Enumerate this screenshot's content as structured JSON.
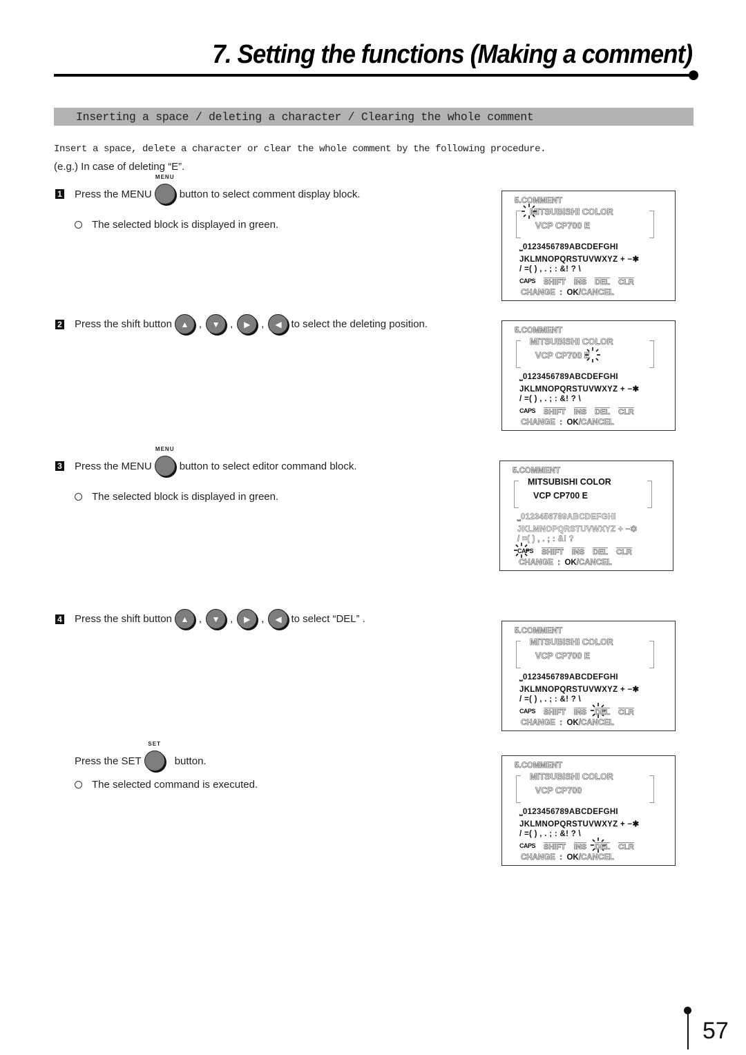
{
  "header": {
    "title": "7. Setting the functions (Making a comment)"
  },
  "section": {
    "heading": "Inserting a space / deleting a character / Clearing the whole comment",
    "intro": "Insert a space, delete a character or clear the whole comment by the following procedure.",
    "example": "(e.g.) In case of deleting “E”."
  },
  "buttons": {
    "menu_caption": "MENU",
    "set_caption": "SET",
    "up_icon": "▲",
    "down_icon": "▼",
    "right_icon": "▶",
    "left_icon": "◀"
  },
  "steps": [
    {
      "number": "1",
      "before": "Press the MENU",
      "after": "button to select comment display block.",
      "note": "The selected block is displayed in green."
    },
    {
      "number": "2",
      "before": "Press the shift button",
      "after": "to select the deleting position."
    },
    {
      "number": "3",
      "before": "Press the MENU",
      "after": "button to select editor command block.",
      "note": "The selected block is displayed in green."
    },
    {
      "number": "4",
      "before": "Press the shift button",
      "after": "to select  “DEL” ."
    },
    {
      "number": "",
      "before": "Press the SET",
      "after": "button.",
      "note": "The selected command is executed."
    }
  ],
  "screens": [
    {
      "title": "5.COMMENT",
      "line1": "MITSUBISHI  COLOR",
      "line2": "VCP CP700 E",
      "chars1": "⎵0123456789ABCDEFGHI",
      "chars2": "JKLMNOPQRSTUVWXYZ + −✱",
      "chars3": "/ =( ) , . ; : &! ? \\",
      "commands": [
        "CAPS",
        "SHIFT",
        "INS",
        "DEL",
        "CLR"
      ],
      "change": "CHANGE",
      "colon": ":",
      "ok": "OK",
      "cancel": "/CANCEL",
      "cursor": "M"
    },
    {
      "title": "5.COMMENT",
      "line1": "MITSUBISHI  COLOR",
      "line2": "VCP CP700 E",
      "chars1": "⎵0123456789ABCDEFGHI",
      "chars2": "JKLMNOPQRSTUVWXYZ + −✱",
      "chars3": "/ =( ) , . ; : &! ? \\",
      "commands": [
        "CAPS",
        "SHIFT",
        "INS",
        "DEL",
        "CLR"
      ],
      "change": "CHANGE",
      "colon": ":",
      "ok": "OK",
      "cancel": "/CANCEL",
      "cursor": "E"
    },
    {
      "title": "5.COMMENT",
      "line1": "MITSUBISHI  COLOR",
      "line2": "VCP CP700 E",
      "chars1": "⎵0123456789ABCDEFGHI",
      "chars2": "JKLMNOPQRSTUVWXYZ + −✱",
      "chars3": "/ =( ) , . ; : &! ?",
      "commands": [
        "CAPS",
        "SHIFT",
        "INS",
        "DEL",
        "CLR"
      ],
      "change": "CHANGE",
      "colon": ":",
      "ok": "OK",
      "cancel": "/CANCEL",
      "cursor": "CAPS"
    },
    {
      "title": "5.COMMENT",
      "line1": "MITSUBISHI  COLOR",
      "line2": "VCP CP700 E",
      "chars1": "⎵0123456789ABCDEFGHI",
      "chars2": "JKLMNOPQRSTUVWXYZ + −✱",
      "chars3": "/ =( ) , . ; : &! ? \\",
      "commands": [
        "CAPS",
        "SHIFT",
        "INS",
        "DEL",
        "CLR"
      ],
      "change": "CHANGE",
      "colon": ":",
      "ok": "OK",
      "cancel": "/CANCEL",
      "cursor": "DEL"
    },
    {
      "title": "5.COMMENT",
      "line1": "MITSUBISHI  COLOR",
      "line2": "VCP CP700",
      "chars1": "⎵0123456789ABCDEFGHI",
      "chars2": "JKLMNOPQRSTUVWXYZ + −✱",
      "chars3": "/ =( ) , . ; : &! ? \\",
      "commands": [
        "CAPS",
        "SHIFT",
        "INS",
        "DEL",
        "CLR"
      ],
      "change": "CHANGE",
      "colon": ":",
      "ok": "OK",
      "cancel": "/CANCEL",
      "cursor": "DEL"
    }
  ],
  "footer": {
    "page_number": "57"
  }
}
